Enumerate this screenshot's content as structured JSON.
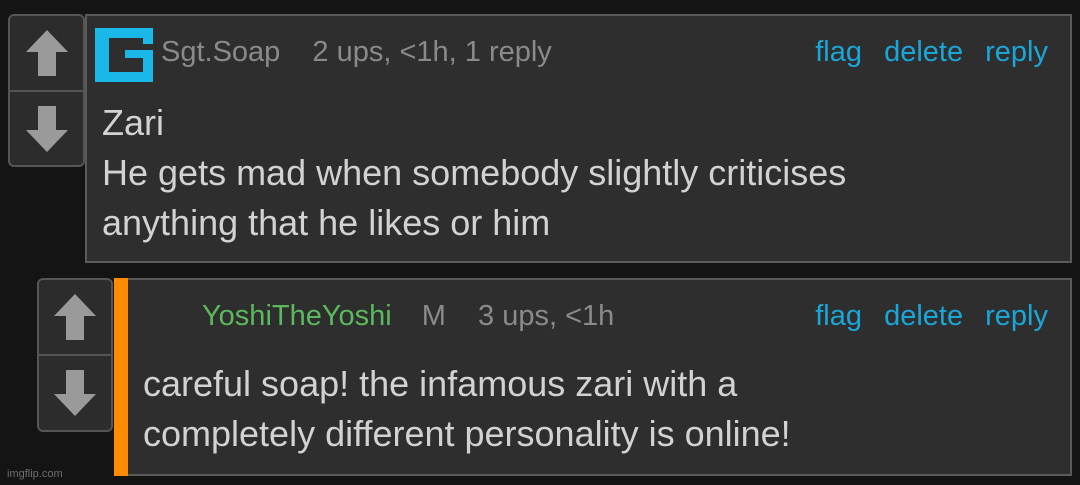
{
  "comments": [
    {
      "username": "Sgt.Soap",
      "meta": "2 ups, <1h, 1 reply",
      "actions": {
        "flag": "flag",
        "delete": "delete",
        "reply": "reply"
      },
      "lines": [
        "Zari",
        "He gets mad when somebody slightly criticises",
        "anything that he likes or him"
      ],
      "avatar_color": "#19b8e8"
    },
    {
      "username": "YoshiTheYoshi",
      "mod_badge": "M",
      "meta": "3 ups, <1h",
      "actions": {
        "flag": "flag",
        "delete": "delete",
        "reply": "reply"
      },
      "lines": [
        "careful soap! the infamous zari with a",
        "completely different personality is online!"
      ],
      "username_color": "#5cb85c",
      "accent_color": "#ff8c00"
    }
  ],
  "icons": {
    "upvote": "arrow-up-icon",
    "downvote": "arrow-down-icon",
    "avatar": "pixel-logo-icon"
  },
  "watermark": "imgflip.com"
}
